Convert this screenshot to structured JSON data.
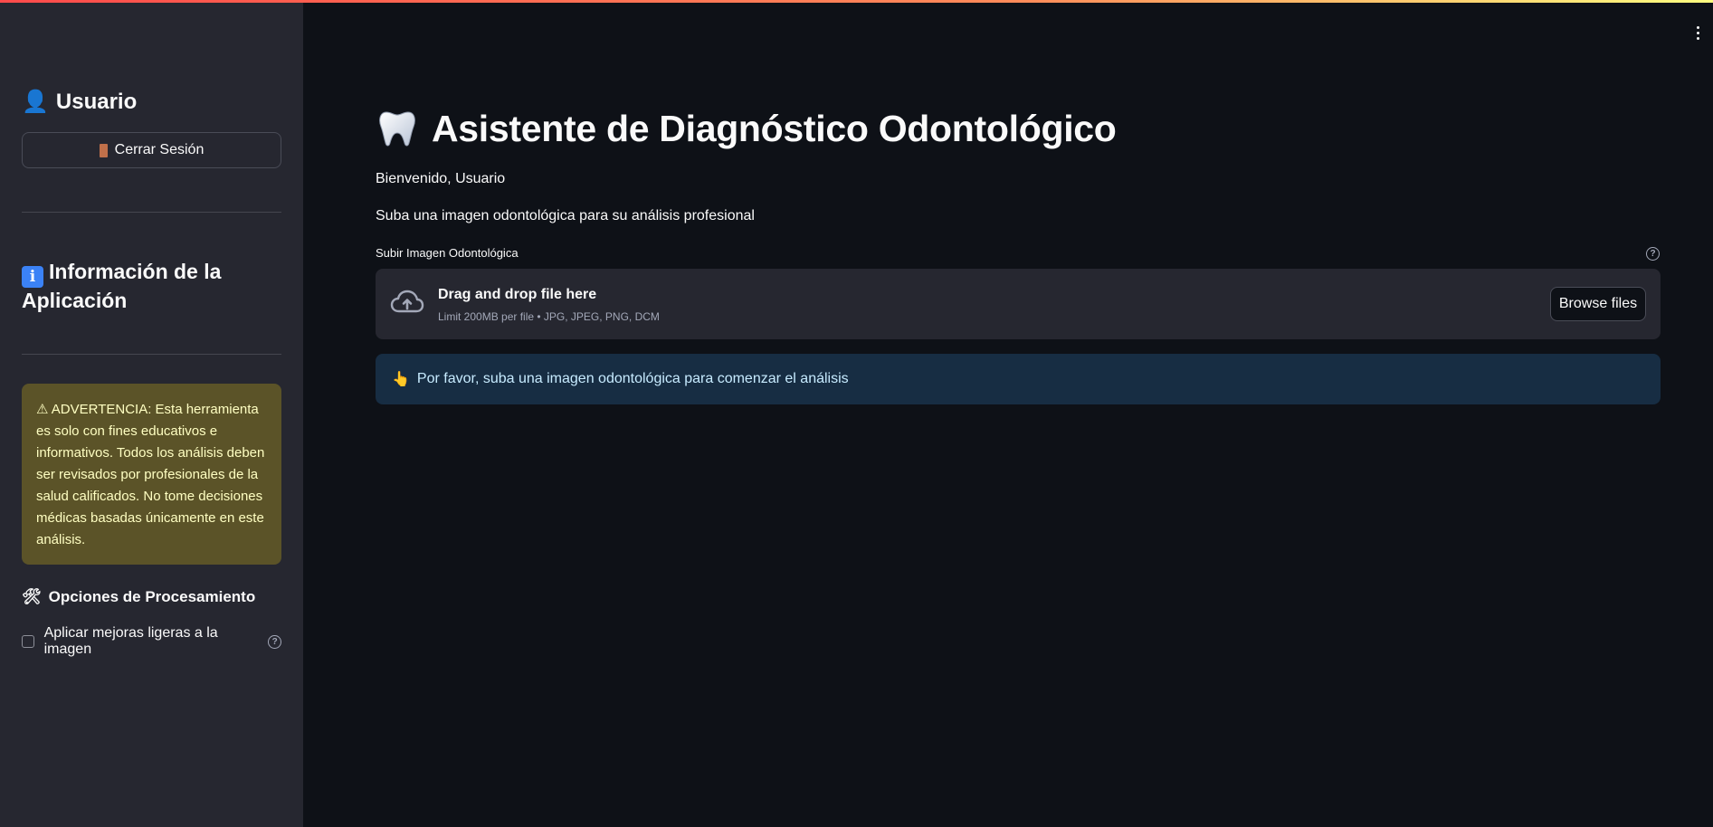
{
  "colors": {
    "background": "#0e1117",
    "sidebar": "#262730",
    "warning_bg": "#5b5328",
    "warning_text": "#ffffc2",
    "info_bg": "#172d43",
    "info_text": "#c7ebff"
  },
  "sidebar": {
    "user_icon": "👤",
    "user_heading": "Usuario",
    "logout_label": "Cerrar Sesión",
    "info_heading": "Información de la Aplicación",
    "warning_text": "⚠ ADVERTENCIA: Esta herramienta es solo con fines educativos e informativos. Todos los análisis deben ser revisados por profesionales de la salud calificados. No tome decisiones médicas basadas únicamente en este análisis.",
    "processing_icon": "🛠",
    "processing_heading": "Opciones de Procesamiento",
    "enhance_checkbox_label": "Aplicar mejoras ligeras a la imagen",
    "enhance_checked": false
  },
  "main": {
    "title": "Asistente de Diagnóstico Odontológico",
    "welcome": "Bienvenido, Usuario",
    "subtitle": "Suba una imagen odontológica para su análisis profesional",
    "uploader": {
      "label": "Subir Imagen Odontológica",
      "drop_title": "Drag and drop file here",
      "limit_text": "Limit 200MB per file • JPG, JPEG, PNG, DCM",
      "browse_label": "Browse files"
    },
    "info_icon": "👆",
    "info_message": "Por favor, suba una imagen odontológica para comenzar el análisis"
  },
  "icons": {
    "menu": "kebab-menu-icon",
    "help": "?"
  }
}
